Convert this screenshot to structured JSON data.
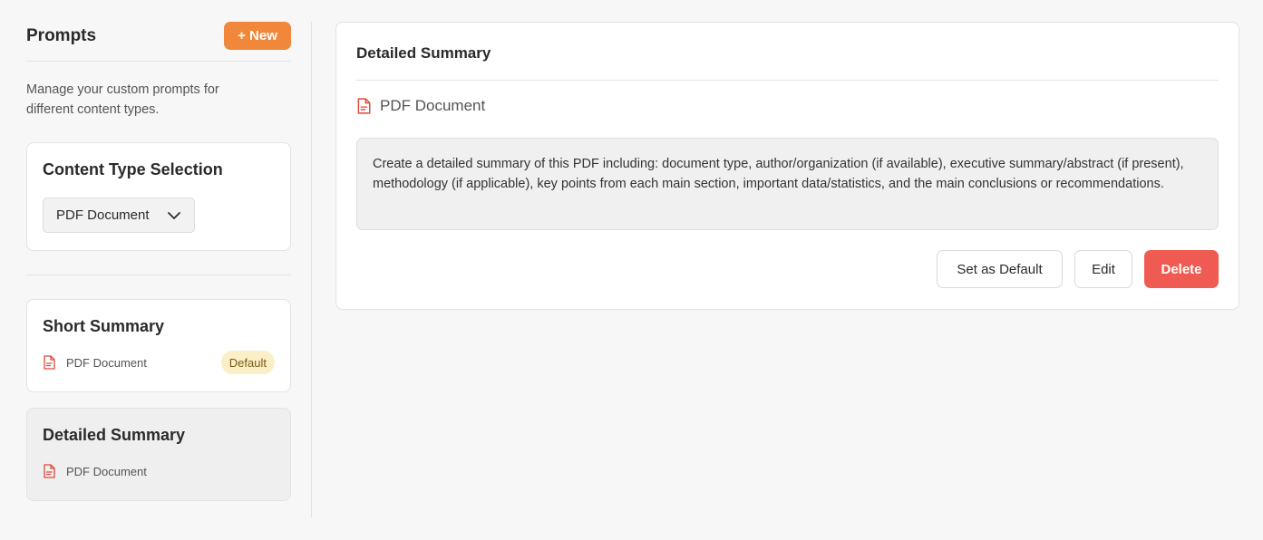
{
  "sidebar": {
    "title": "Prompts",
    "new_button": "+ New",
    "description": "Manage your custom prompts for different content types.",
    "content_type": {
      "title": "Content Type Selection",
      "selected": "PDF Document"
    },
    "prompts": [
      {
        "title": "Short Summary",
        "type": "PDF Document",
        "badge": "Default"
      },
      {
        "title": "Detailed Summary",
        "type": "PDF Document"
      }
    ]
  },
  "main": {
    "title": "Detailed Summary",
    "type": "PDF Document",
    "prompt_text": "Create a detailed summary of this PDF including: document type, author/organization (if available), executive summary/abstract (if present), methodology (if applicable), key points from each main section, important data/statistics, and the main conclusions or recommendations.",
    "buttons": {
      "set_default": "Set as Default",
      "edit": "Edit",
      "delete": "Delete"
    }
  },
  "colors": {
    "accent": "#f0873a",
    "danger": "#ef5a52",
    "pdf_icon": "#e0473c",
    "badge_bg": "#fbefc7"
  },
  "icons": {
    "document": "pdf-file-icon",
    "dropdown": "chevron-down-icon"
  }
}
